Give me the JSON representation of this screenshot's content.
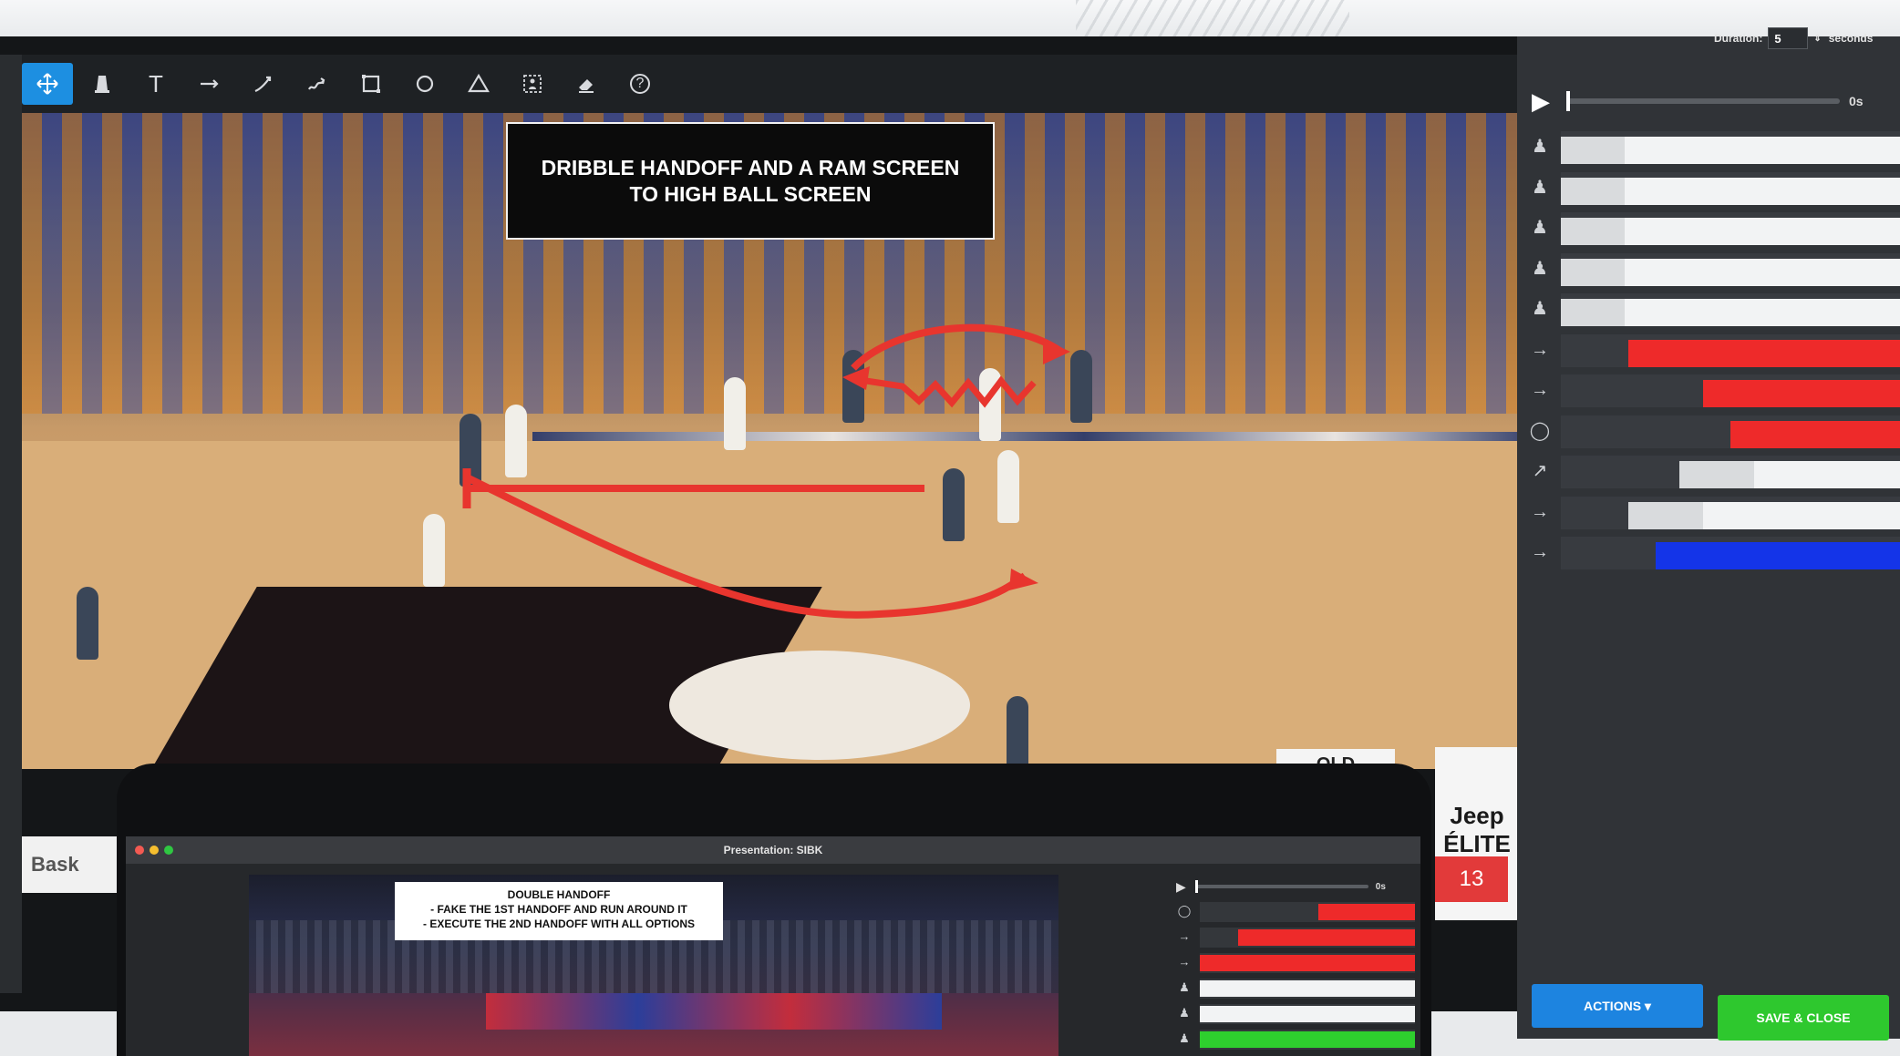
{
  "toolbar": {
    "tools": [
      "move-tool",
      "player-tool",
      "text-tool",
      "arrow-tool",
      "curved-arrow-tool",
      "dribble-arrow-tool",
      "rectangle-tool",
      "circle-tool",
      "triangle-tool",
      "spotlight-tool",
      "eraser-tool",
      "help-tool"
    ],
    "text_tool_glyph": "T",
    "help_glyph": "?"
  },
  "video": {
    "annotation_title": "DRIBBLE HANDOFF AND A RAM SCREEN TO HIGH BALL SCREEN",
    "scoreboard_team": "OLD",
    "scoreboard_logo": "Jeep ÉLITE",
    "scoreboard_number": "13",
    "corner_logo_text": "Bask"
  },
  "timeline": {
    "duration_label": "Duration:",
    "duration_value": "5",
    "duration_unit": "seconds",
    "time_readout": "0s",
    "tracks": [
      {
        "icon": "player-icon",
        "glyph": "♟",
        "color": "#f2f3f4",
        "start": 0.0,
        "end": 1.0,
        "lite": true
      },
      {
        "icon": "player-icon",
        "glyph": "♟",
        "color": "#f2f3f4",
        "start": 0.0,
        "end": 1.0,
        "lite": true
      },
      {
        "icon": "player-icon",
        "glyph": "♟",
        "color": "#f2f3f4",
        "start": 0.0,
        "end": 1.0,
        "lite": true
      },
      {
        "icon": "player-icon",
        "glyph": "♟",
        "color": "#f2f3f4",
        "start": 0.0,
        "end": 1.0,
        "lite": true
      },
      {
        "icon": "player-icon",
        "glyph": "♟",
        "color": "#f2f3f4",
        "start": 0.0,
        "end": 1.0,
        "lite": true
      },
      {
        "icon": "arrow-icon",
        "glyph": "→",
        "color": "#ee2a2a",
        "start": 0.2,
        "end": 1.0,
        "lite": false
      },
      {
        "icon": "arrow-icon",
        "glyph": "→",
        "color": "#ee2a2a",
        "start": 0.42,
        "end": 1.0,
        "lite": false
      },
      {
        "icon": "circle-icon",
        "glyph": "◯",
        "color": "#ee2a2a",
        "start": 0.5,
        "end": 1.0,
        "lite": false
      },
      {
        "icon": "curved-arrow-icon",
        "glyph": "↗",
        "color": "#f2f3f4",
        "start": 0.35,
        "end": 1.0,
        "lite": true
      },
      {
        "icon": "arrow-icon",
        "glyph": "→",
        "color": "#f2f3f4",
        "start": 0.2,
        "end": 1.0,
        "lite": true
      },
      {
        "icon": "arrow-icon",
        "glyph": "→",
        "color": "#1434e8",
        "start": 0.28,
        "end": 1.0,
        "lite": false
      }
    ]
  },
  "buttons": {
    "actions": "ACTIONS ▾",
    "save_close": "SAVE & CLOSE"
  },
  "laptop": {
    "window_title": "Presentation: SIBK",
    "annotation_line1": "DOUBLE HANDOFF",
    "annotation_line2": "- FAKE THE 1ST HANDOFF AND RUN AROUND IT",
    "annotation_line3": "- EXECUTE THE 2ND HANDOFF WITH ALL OPTIONS",
    "time_readout": "0s",
    "tracks": [
      {
        "icon": "circle-icon",
        "glyph": "◯",
        "color": "#ee2a2a",
        "start": 0.55,
        "end": 1.0
      },
      {
        "icon": "arrow-icon",
        "glyph": "→",
        "color": "#ee2a2a",
        "start": 0.18,
        "end": 1.0
      },
      {
        "icon": "arrow-icon",
        "glyph": "→",
        "color": "#ee2a2a",
        "start": 0.0,
        "end": 1.0
      },
      {
        "icon": "player-icon",
        "glyph": "♟",
        "color": "#f2f3f4",
        "start": 0.0,
        "end": 1.0
      },
      {
        "icon": "player-icon",
        "glyph": "♟",
        "color": "#f2f3f4",
        "start": 0.0,
        "end": 1.0
      },
      {
        "icon": "player-icon",
        "glyph": "♟",
        "color": "#2ecf2e",
        "start": 0.0,
        "end": 1.0
      }
    ]
  }
}
